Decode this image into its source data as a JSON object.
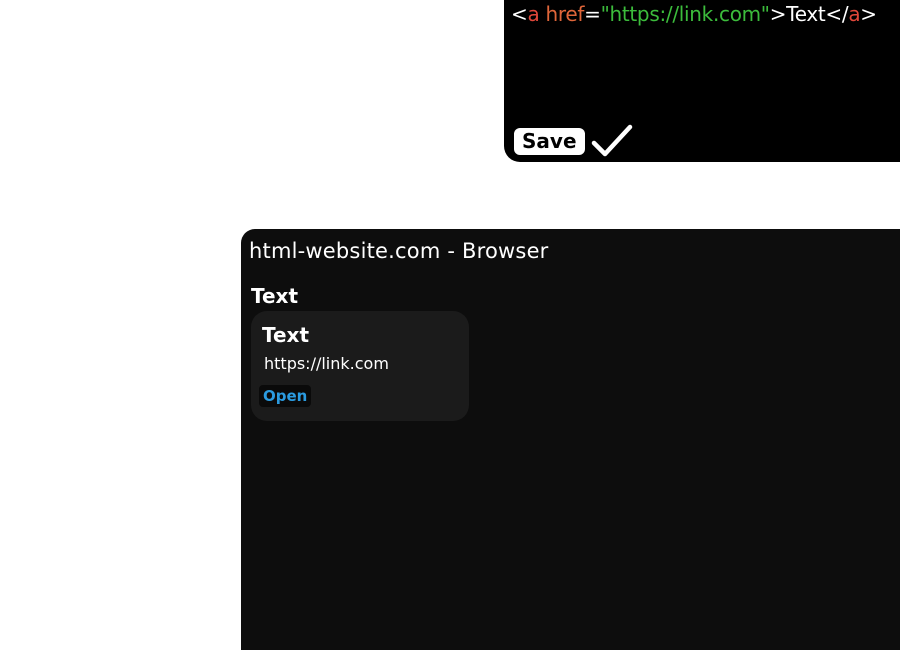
{
  "editor": {
    "code_tokens": [
      {
        "text": "<",
        "kind": "plain"
      },
      {
        "text": "a",
        "kind": "tag"
      },
      {
        "text": " href",
        "kind": "attr"
      },
      {
        "text": "=",
        "kind": "plain"
      },
      {
        "text": "\"https://link.com\"",
        "kind": "str"
      },
      {
        "text": ">Text</",
        "kind": "plain"
      },
      {
        "text": "a",
        "kind": "tag"
      },
      {
        "text": ">",
        "kind": "plain"
      }
    ],
    "save_label": "Save",
    "confirm_icon": "checkmark-icon"
  },
  "browser": {
    "title": "html-website.com - Browser",
    "page_heading": "Text",
    "link_card": {
      "title": "Text",
      "url": "https://link.com",
      "open_label": "Open"
    }
  },
  "colors": {
    "tag": "#e0473a",
    "attribute": "#e0663a",
    "string": "#3cbc3c",
    "link_button": "#2b9be0",
    "browser_bg": "#0d0d0d",
    "card_bg": "#1b1b1b"
  }
}
